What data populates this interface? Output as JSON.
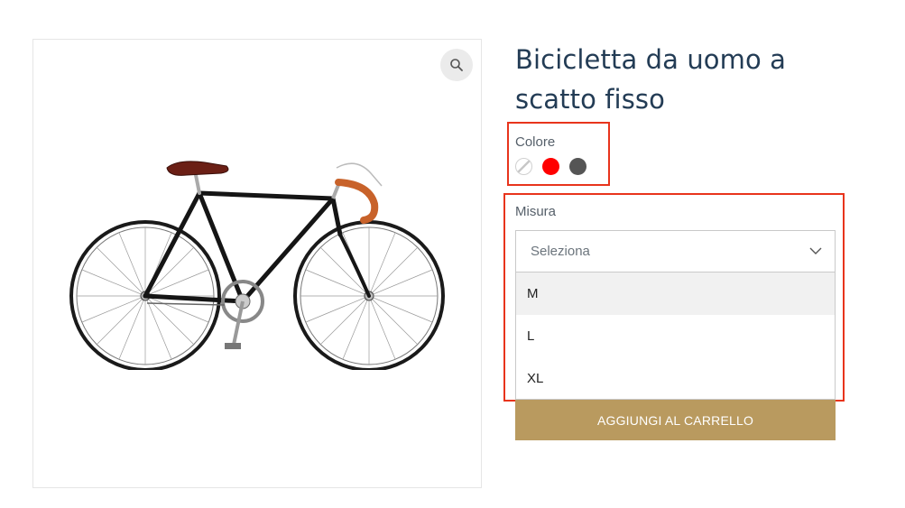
{
  "product": {
    "title_line1": "Bicicletta da uomo a",
    "title_line2": "scatto fisso"
  },
  "gallery": {
    "zoom_icon": "magnifier-icon",
    "image_subject": "bicycle"
  },
  "color_attribute": {
    "label": "Colore",
    "swatches": [
      {
        "name": "none",
        "color": "#ffffff"
      },
      {
        "name": "red",
        "color": "#ff0000"
      },
      {
        "name": "dark-gray",
        "color": "#555555"
      }
    ]
  },
  "size_attribute": {
    "label": "Misura",
    "placeholder": "Seleziona",
    "options": [
      "M",
      "L",
      "XL"
    ],
    "highlighted_option": "M"
  },
  "cart": {
    "add_to_cart_label": "AGGIUNGI AL CARRELLO"
  },
  "colors": {
    "highlight_border": "#e8341c",
    "button_bg": "#b99a5f",
    "title": "#233c55"
  }
}
